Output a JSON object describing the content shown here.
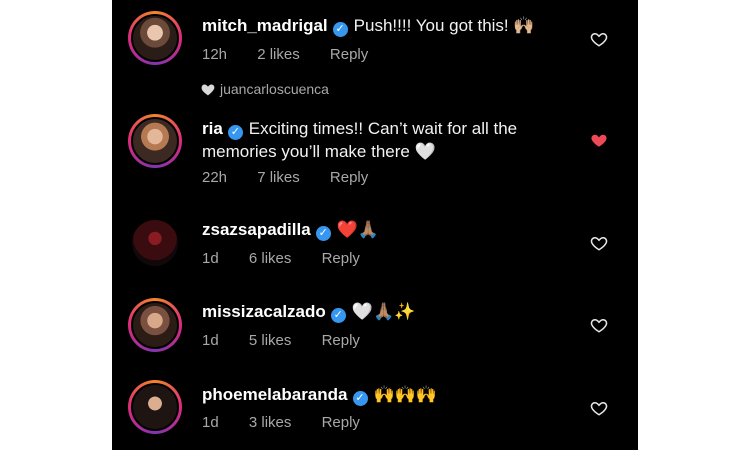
{
  "comments": [
    {
      "username": "mitch_madrigal",
      "text": "Push!!!! You got this! 🙌🏼",
      "time": "12h",
      "likes": "2 likes",
      "reply": "Reply",
      "liked": false
    },
    {
      "username": "ria",
      "text_line1": "Exciting times!! Can’t wait for all the",
      "text_line2": "memories you’ll make there 🤍",
      "time": "22h",
      "likes": "7 likes",
      "reply": "Reply",
      "liked": true
    },
    {
      "username": "zsazsapadilla",
      "text": "❤️🙏🏽",
      "time": "1d",
      "likes": "6 likes",
      "reply": "Reply",
      "liked": false
    },
    {
      "username": "missizacalzado",
      "text": "🤍🙏🏽✨",
      "time": "1d",
      "likes": "5 likes",
      "reply": "Reply",
      "liked": false
    },
    {
      "username": "phoemelabaranda",
      "text": "🙌🙌🙌",
      "time": "1d",
      "likes": "3 likes",
      "reply": "Reply",
      "liked": false
    }
  ],
  "liked_by": {
    "username": "juancarloscuenca"
  },
  "colors": {
    "background": "#000000",
    "text": "#ffffff",
    "meta": "#a8a8a8",
    "verified": "#3797f0",
    "liked_heart": "#ed4956"
  },
  "icons": {
    "verified": "verified-badge-icon",
    "like": "heart-outline-icon",
    "liked": "heart-filled-icon"
  }
}
